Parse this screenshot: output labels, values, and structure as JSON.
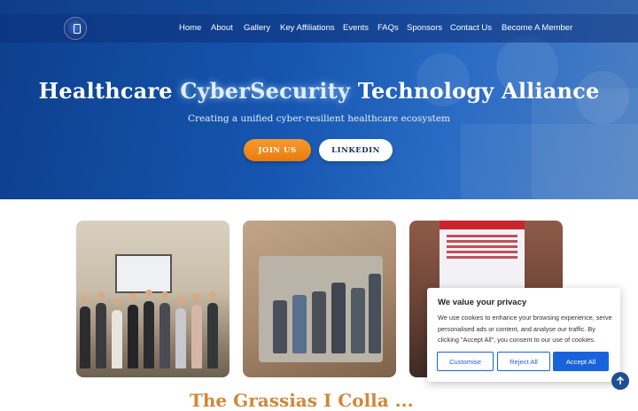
{
  "nav": {
    "items": [
      "Home",
      "About",
      "Gallery",
      "Key Affiliations",
      "Events",
      "FAQs",
      "Sponsors",
      "Contact Us",
      "Become A Member"
    ]
  },
  "hero": {
    "title_part1": "Healthcare ",
    "title_highlight": "CyberSecurity",
    "title_part2": " Technology Alliance",
    "subtitle": "Creating a unified cyber-resilient healthcare ecosystem",
    "join_label": "JOIN US",
    "linkedin_label": "LINKEDIN"
  },
  "section": {
    "title": "The Grassias I Colla ..."
  },
  "cookie": {
    "title": "We value your privacy",
    "body": "We use cookies to enhance your browsing experience, serve personalised ads or content, and analyse our traffic. By clicking \"Accept All\", you consent to our use of cookies.",
    "customise": "Customise",
    "reject": "Reject All",
    "accept": "Accept All"
  },
  "icons": {
    "logo": "alliance-logo",
    "scroll_top": "arrow-up-icon"
  },
  "colors": {
    "hero_blue": "#1656b0",
    "join_orange": "#ea7b10",
    "cookie_blue": "#1863dc",
    "section_title": "#d2873b"
  }
}
